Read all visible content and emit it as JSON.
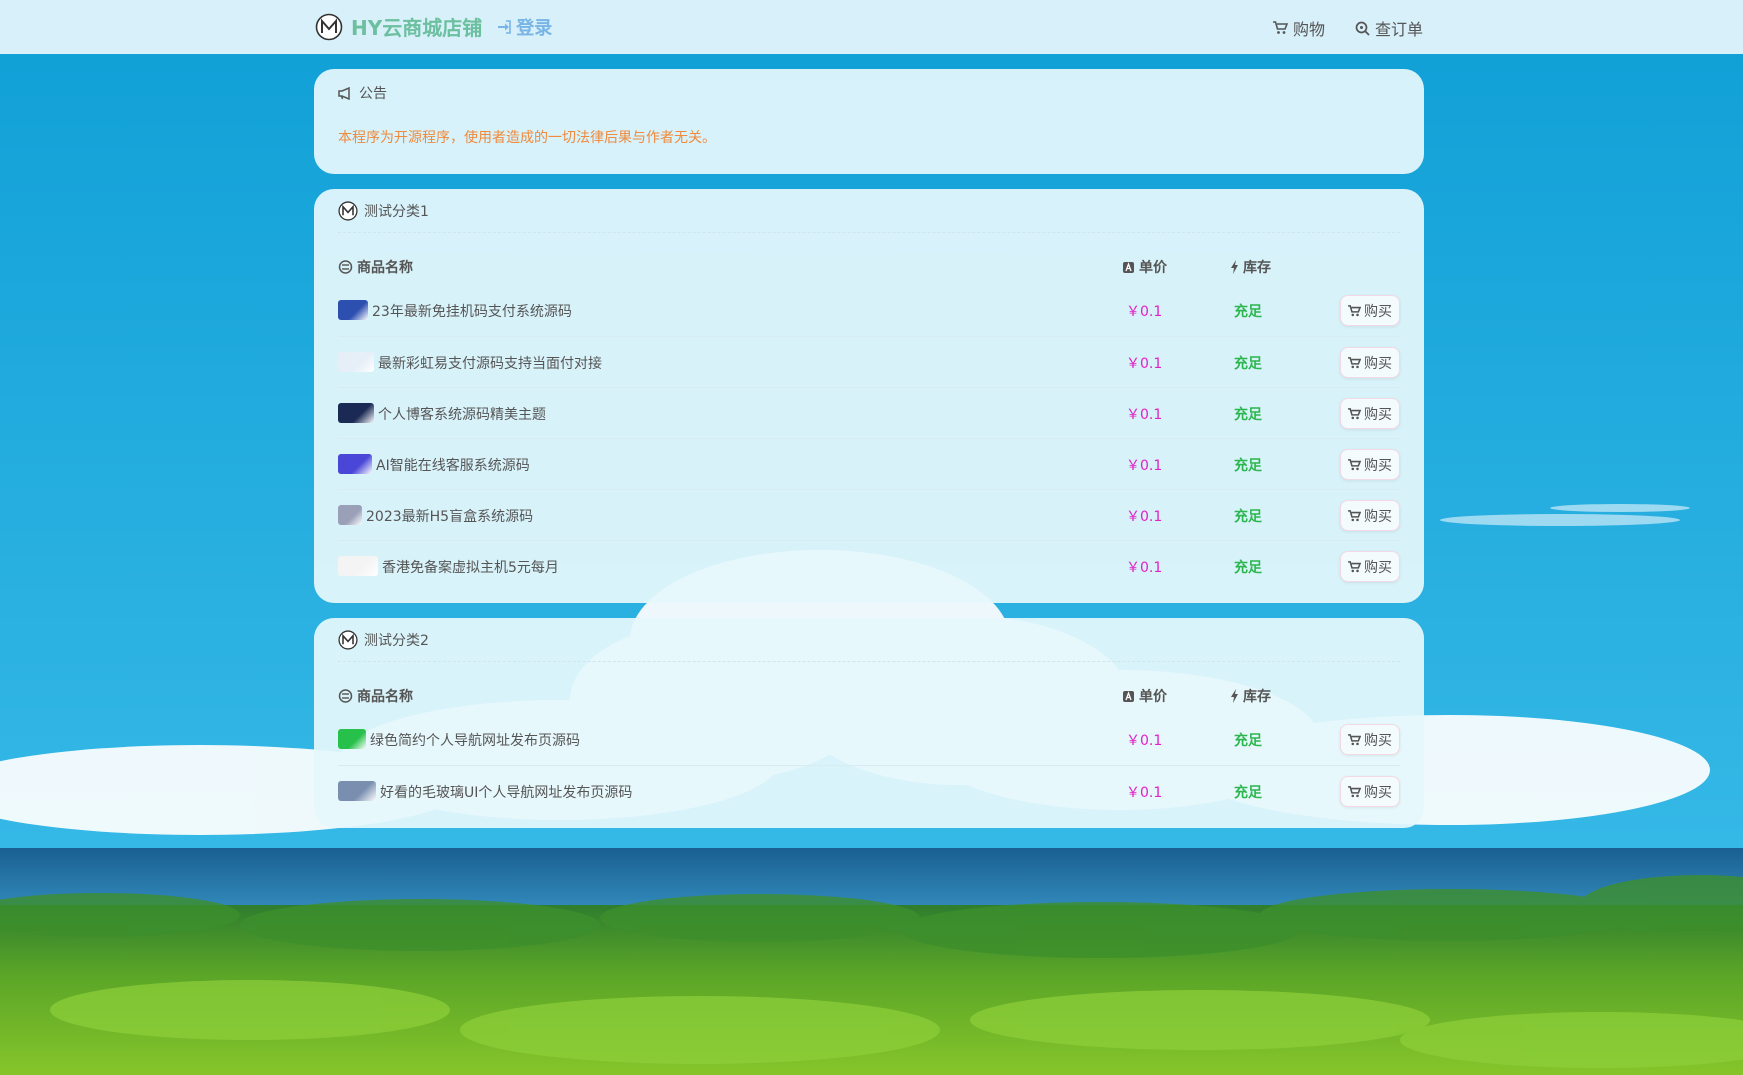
{
  "header": {
    "title": "HY云商城店铺",
    "login_label": "登录",
    "nav": [
      {
        "label": "购物",
        "icon": "cart-icon"
      },
      {
        "label": "查订单",
        "icon": "search-order-icon"
      }
    ]
  },
  "notice": {
    "title": "公告",
    "text": "本程序为开源程序，使用者造成的一切法律后果与作者无关。"
  },
  "table_headers": {
    "name": "商品名称",
    "price": "单价",
    "stock": "库存"
  },
  "categories": [
    {
      "title": "测试分类1",
      "products": [
        {
          "name": "23年最新免挂机码支付系统源码",
          "price": "￥0.1",
          "stock": "充足",
          "buy": "购买",
          "thumb_color": "#2d4fb0"
        },
        {
          "name": "最新彩虹易支付源码支持当面付对接",
          "price": "￥0.1",
          "stock": "充足",
          "buy": "购买",
          "thumb_color": "#e6eef8"
        },
        {
          "name": "个人博客系统源码精美主题",
          "price": "￥0.1",
          "stock": "充足",
          "buy": "购买",
          "thumb_color": "#1b2a55"
        },
        {
          "name": "AI智能在线客服系统源码",
          "price": "￥0.1",
          "stock": "充足",
          "buy": "购买",
          "thumb_color": "#4a46d8"
        },
        {
          "name": "2023最新H5盲盒系统源码",
          "price": "￥0.1",
          "stock": "充足",
          "buy": "购买",
          "thumb_color": "#9aa0b8"
        },
        {
          "name": "香港免备案虚拟主机5元每月",
          "price": "￥0.1",
          "stock": "充足",
          "buy": "购买",
          "thumb_color": "#f4f4f4"
        }
      ]
    },
    {
      "title": "测试分类2",
      "products": [
        {
          "name": "绿色简约个人导航网址发布页源码",
          "price": "￥0.1",
          "stock": "充足",
          "buy": "购买",
          "thumb_color": "#26c04a"
        },
        {
          "name": "好看的毛玻璃UI个人导航网址发布页源码",
          "price": "￥0.1",
          "stock": "充足",
          "buy": "购买",
          "thumb_color": "#7a8fb0"
        }
      ]
    }
  ]
}
